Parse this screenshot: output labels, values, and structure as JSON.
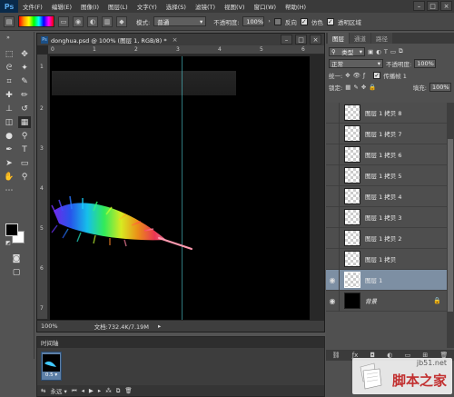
{
  "app": {
    "logo": "Ps"
  },
  "menu": [
    "文件(F)",
    "编辑(E)",
    "图像(I)",
    "图层(L)",
    "文字(Y)",
    "选择(S)",
    "滤镜(T)",
    "视图(V)",
    "窗口(W)",
    "帮助(H)"
  ],
  "window_controls": {
    "minimize": "–",
    "restore": "□",
    "close": "×"
  },
  "options": {
    "mode_label": "模式:",
    "mode_value": "普通",
    "opacity_label": "不透明度:",
    "opacity_value": "100%",
    "reverse_label": "反向",
    "dither_label": "仿色",
    "transparency_label": "透明区域"
  },
  "document": {
    "title": "donghua.psd @ 100% (图层 1, RGB/8) *",
    "zoom": "100%",
    "doc_info": "文档:732.4K/7.19M",
    "ruler_h": [
      "0",
      "1",
      "2",
      "3",
      "4",
      "5",
      "6"
    ],
    "ruler_v": [
      "1",
      "2",
      "3",
      "4",
      "5",
      "6",
      "7"
    ]
  },
  "timeline": {
    "title": "时间轴",
    "frame_delay": "0.5",
    "loop": "永远"
  },
  "panels": {
    "tabs": [
      "图层",
      "通道",
      "路径"
    ],
    "kind_filter": "类型",
    "blend_mode": "正常",
    "opacity_label": "不透明度:",
    "opacity_value": "100%",
    "unify_label": "统一:",
    "propagate_label": "传播帧 1",
    "lock_label": "锁定:",
    "fill_label": "填充:",
    "fill_value": "100%"
  },
  "layers": [
    {
      "name": "图层 1 拷贝 8",
      "visible": false,
      "selected": false
    },
    {
      "name": "图层 1 拷贝 7",
      "visible": false,
      "selected": false
    },
    {
      "name": "图层 1 拷贝 6",
      "visible": false,
      "selected": false
    },
    {
      "name": "图层 1 拷贝 5",
      "visible": false,
      "selected": false
    },
    {
      "name": "图层 1 拷贝 4",
      "visible": false,
      "selected": false
    },
    {
      "name": "图层 1 拷贝 3",
      "visible": false,
      "selected": false
    },
    {
      "name": "图层 1 拷贝 2",
      "visible": false,
      "selected": false
    },
    {
      "name": "图层 1 拷贝",
      "visible": false,
      "selected": false
    },
    {
      "name": "图层 1",
      "visible": true,
      "selected": true
    },
    {
      "name": "背景",
      "visible": true,
      "selected": false
    }
  ],
  "watermark": {
    "url": "jb51.net",
    "name": "脚本之家"
  }
}
